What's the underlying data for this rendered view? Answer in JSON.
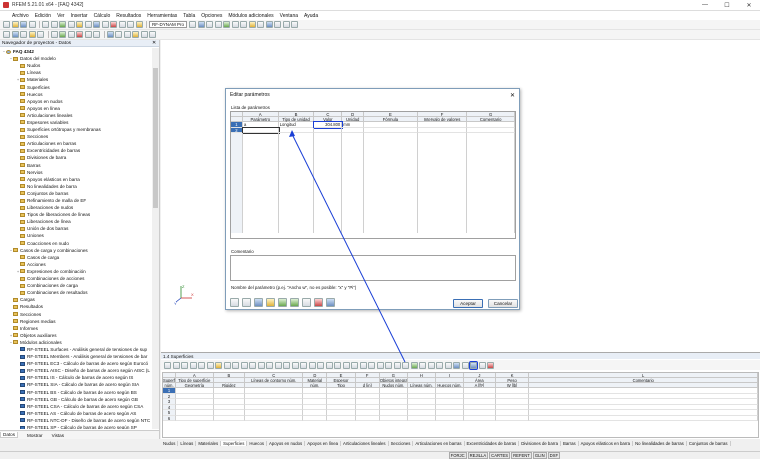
{
  "window": {
    "title": "RFEM 5.21.01 x64 - [FAQ 4342]",
    "controls": [
      "—",
      "☐",
      "✕"
    ]
  },
  "menu": [
    "Archivo",
    "Edición",
    "Ver",
    "Insertar",
    "Cálculo",
    "Resultados",
    "Herramientas",
    "Tabla",
    "Opciones",
    "Módulos adicionales",
    "Ventana",
    "Ayuda"
  ],
  "toolbar": {
    "module_combo": "RF-DYNAM Pro"
  },
  "navigator": {
    "header": "Navegador de proyectos - Datos",
    "close": "✕",
    "items": [
      {
        "label": "FAQ 4342",
        "level": 0,
        "icon": "root",
        "exp": "−"
      },
      {
        "label": "Datos del modelo",
        "level": 1,
        "icon": "folder",
        "exp": "−"
      },
      {
        "label": "Nudos",
        "level": 2,
        "icon": "folder",
        "exp": ""
      },
      {
        "label": "Líneas",
        "level": 2,
        "icon": "folder",
        "exp": ""
      },
      {
        "label": "Materiales",
        "level": 2,
        "icon": "folder",
        "exp": "+"
      },
      {
        "label": "Superficies",
        "level": 2,
        "icon": "folder",
        "exp": ""
      },
      {
        "label": "Huecos",
        "level": 2,
        "icon": "folder",
        "exp": ""
      },
      {
        "label": "Apoyos en nudos",
        "level": 2,
        "icon": "folder",
        "exp": ""
      },
      {
        "label": "Apoyos en línea",
        "level": 2,
        "icon": "folder",
        "exp": ""
      },
      {
        "label": "Articulaciones lineales",
        "level": 2,
        "icon": "folder",
        "exp": ""
      },
      {
        "label": "Espesores variables",
        "level": 2,
        "icon": "folder",
        "exp": ""
      },
      {
        "label": "Superficies ortótropas y membranas",
        "level": 2,
        "icon": "folder",
        "exp": ""
      },
      {
        "label": "Secciones",
        "level": 2,
        "icon": "folder",
        "exp": ""
      },
      {
        "label": "Articulaciones en barras",
        "level": 2,
        "icon": "folder",
        "exp": ""
      },
      {
        "label": "Excentricidades de barras",
        "level": 2,
        "icon": "folder",
        "exp": ""
      },
      {
        "label": "Divisiones de barra",
        "level": 2,
        "icon": "folder",
        "exp": ""
      },
      {
        "label": "Barras",
        "level": 2,
        "icon": "folder",
        "exp": ""
      },
      {
        "label": "Nervios",
        "level": 2,
        "icon": "folder",
        "exp": ""
      },
      {
        "label": "Apoyos elásticos en barra",
        "level": 2,
        "icon": "folder",
        "exp": ""
      },
      {
        "label": "No linealidades de barra",
        "level": 2,
        "icon": "folder",
        "exp": ""
      },
      {
        "label": "Conjuntos de barras",
        "level": 2,
        "icon": "folder",
        "exp": ""
      },
      {
        "label": "Refinamiento de malla de EF",
        "level": 2,
        "icon": "folder",
        "exp": ""
      },
      {
        "label": "Liberaciones de nudos",
        "level": 2,
        "icon": "folder",
        "exp": ""
      },
      {
        "label": "Tipos de liberaciones de líneas",
        "level": 2,
        "icon": "folder",
        "exp": ""
      },
      {
        "label": "Liberaciones de línea",
        "level": 2,
        "icon": "folder",
        "exp": ""
      },
      {
        "label": "Unión de dos barras",
        "level": 2,
        "icon": "folder",
        "exp": ""
      },
      {
        "label": "Uniones",
        "level": 2,
        "icon": "folder",
        "exp": ""
      },
      {
        "label": "Coacciones en nudo",
        "level": 2,
        "icon": "folder",
        "exp": ""
      },
      {
        "label": "Casos de carga y combinaciones",
        "level": 1,
        "icon": "folder",
        "exp": "−"
      },
      {
        "label": "Casos de carga",
        "level": 2,
        "icon": "folder",
        "exp": ""
      },
      {
        "label": "Acciones",
        "level": 2,
        "icon": "folder",
        "exp": ""
      },
      {
        "label": "Expresiones de combinación",
        "level": 2,
        "icon": "folder",
        "exp": "+"
      },
      {
        "label": "Combinaciones de acciones",
        "level": 2,
        "icon": "folder",
        "exp": ""
      },
      {
        "label": "Combinaciones de carga",
        "level": 2,
        "icon": "folder",
        "exp": ""
      },
      {
        "label": "Combinaciones de resultados",
        "level": 2,
        "icon": "folder",
        "exp": ""
      },
      {
        "label": "Cargas",
        "level": 1,
        "icon": "folder",
        "exp": ""
      },
      {
        "label": "Resultados",
        "level": 1,
        "icon": "folder",
        "exp": ""
      },
      {
        "label": "Secciones",
        "level": 1,
        "icon": "folder",
        "exp": ""
      },
      {
        "label": "Regiones medias",
        "level": 1,
        "icon": "folder",
        "exp": ""
      },
      {
        "label": "Informes",
        "level": 1,
        "icon": "folder",
        "exp": ""
      },
      {
        "label": "Objetos auxiliares",
        "level": 1,
        "icon": "folder",
        "exp": "+"
      },
      {
        "label": "Módulos adicionales",
        "level": 1,
        "icon": "folder",
        "exp": "−"
      },
      {
        "label": "RF-STEEL Surfaces - Análisis general de tensiones de sup",
        "level": 2,
        "icon": "module",
        "exp": ""
      },
      {
        "label": "RF-STEEL Members - Análisis general de tensiones de bar",
        "level": 2,
        "icon": "module",
        "exp": ""
      },
      {
        "label": "RF-STEEL EC3 - Cálculo de barras de acero según Eurocó",
        "level": 2,
        "icon": "module",
        "exp": ""
      },
      {
        "label": "RF-STEEL AISC - Diseño de barras de acero según AISC (L",
        "level": 2,
        "icon": "module",
        "exp": ""
      },
      {
        "label": "RF-STEEL IS - Cálculo de barras de acero según IS",
        "level": 2,
        "icon": "module",
        "exp": ""
      },
      {
        "label": "RF-STEEL SIA - Cálculo de barras de acero según SIA",
        "level": 2,
        "icon": "module",
        "exp": ""
      },
      {
        "label": "RF-STEEL BS - Cálculo de barras de acero según BS",
        "level": 2,
        "icon": "module",
        "exp": ""
      },
      {
        "label": "RF-STEEL GB - Cálculo de barras de acero según GB",
        "level": 2,
        "icon": "module",
        "exp": ""
      },
      {
        "label": "RF-STEEL CSA - Cálculo de barras de acero según CSA",
        "level": 2,
        "icon": "module",
        "exp": ""
      },
      {
        "label": "RF-STEEL AS - Cálculo de barras de acero según AS",
        "level": 2,
        "icon": "module",
        "exp": ""
      },
      {
        "label": "RF-STEEL NTC-DF - Diseño de barras de acero según NTC",
        "level": 2,
        "icon": "module",
        "exp": ""
      },
      {
        "label": "RF-STEEL SP - Cálculo de barras de acero según SP",
        "level": 2,
        "icon": "module",
        "exp": ""
      }
    ],
    "tabs": [
      "Datos",
      "Mostrar",
      "Vistas"
    ]
  },
  "axes": {
    "x": "X",
    "y": "Y",
    "z": "Z"
  },
  "dialog": {
    "title": "Editar parámetros",
    "close": "✕",
    "list_label": "Lista de parámetros",
    "col_letters": [
      "",
      "A",
      "B",
      "C",
      "D",
      "E",
      "F",
      "G"
    ],
    "col_names": [
      "",
      "Parámetro",
      "Tipo de unidad",
      "Valor",
      "Unidad",
      "Fórmula",
      "Intervalo de valores",
      "Comentario"
    ],
    "rows": [
      {
        "num": "1",
        "param": "a",
        "unit_type": "Longitud",
        "value": "304.800",
        "unit": "mm"
      },
      {
        "num": "2",
        "param": "",
        "unit_type": "",
        "value": "",
        "unit": ""
      }
    ],
    "comment_label": "Comentario",
    "hint": "Nombre del parámetro (p.ej. \"Ancho w\", no es posible: \"x\" y \"Pi\")",
    "ok": "Aceptar",
    "cancel": "Cancelar"
  },
  "panel": {
    "title": "1.4 Superficies",
    "col_letters": [
      "",
      "A",
      "B",
      "C",
      "D",
      "E",
      "F",
      "G",
      "H",
      "I",
      "J",
      "K",
      "L"
    ],
    "col_groups": [
      "Superf.",
      "Tipo de superficie",
      "",
      "Líneas de contorno núm.",
      "Material",
      "Espesor",
      "",
      "Objetos integrados",
      "",
      "",
      "Área",
      "Peso",
      "Comentario"
    ],
    "col_names": [
      "núm.",
      "Geometría",
      "Rigidez",
      "",
      "núm.",
      "Tipo",
      "d [in]",
      "Nudos núm.",
      "Líneas núm.",
      "Huecos núm.",
      "A [ft²]",
      "W [lb]",
      ""
    ],
    "rows": [
      "1",
      "2",
      "3",
      "4",
      "5",
      "6"
    ],
    "tabs": [
      "Nudos",
      "Líneas",
      "Materiales",
      "Superficies",
      "Huecos",
      "Apoyos en nudos",
      "Apoyos en línea",
      "Articulaciones lineales",
      "Secciones",
      "Articulaciones en barras",
      "Excentricidades de barras",
      "Divisiones de barra",
      "Barras",
      "Apoyos elásticos en barra",
      "No linealidades de barras",
      "Conjuntos de barras"
    ],
    "active_tab": "Superficies"
  },
  "status": [
    "FORJC",
    "REJILLA",
    "CARTES",
    "REFENT",
    "GLIN",
    "DXF"
  ],
  "colors": {
    "accent": "#3a6fb5",
    "highlight": "#1a3fd6"
  }
}
